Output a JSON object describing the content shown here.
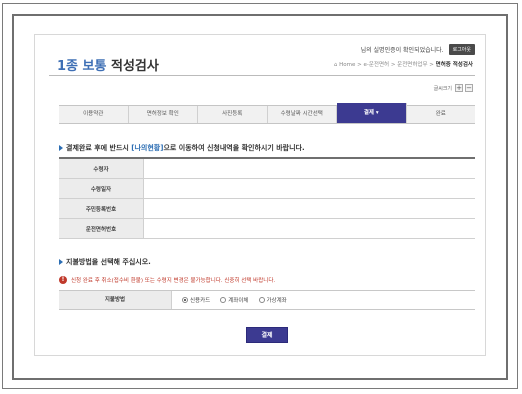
{
  "header": {
    "title_prefix": "1종 보통",
    "title": "적성검사",
    "user_message": "님의 실명인증이 확인되었습니다.",
    "logout_label": "로그아웃",
    "breadcrumb": {
      "home": "Home",
      "path": "> e-운전면허 > 운전면허업무 >",
      "current": "면허증 적성검사"
    }
  },
  "font_size": {
    "label": "글씨크기",
    "plus": "+",
    "minus": "−"
  },
  "steps": [
    {
      "label": "이용약관",
      "active": false
    },
    {
      "label": "면허정보 확인",
      "active": false
    },
    {
      "label": "사진등록",
      "active": false
    },
    {
      "label": "수령날짜 시간선택",
      "active": false
    },
    {
      "label": "결제 ▾",
      "active": true
    },
    {
      "label": "완료",
      "active": false
    }
  ],
  "notice": {
    "before": "결제완료 후에 반드시 ",
    "link": "[나의현황]",
    "after": "으로 이동하여 신청내역을 확인하시기 바랍니다."
  },
  "info_table": {
    "rows": [
      {
        "label": "수령자",
        "value": ""
      },
      {
        "label": "수령일자",
        "value": ""
      },
      {
        "label": "주민등록번호",
        "value": ""
      },
      {
        "label": "운전면허번호",
        "value": ""
      }
    ]
  },
  "payment": {
    "heading": "지불방법을 선택해 주십시오.",
    "warning": "신청 완료 후 취소(접수비 환불) 또는 수령지 변경은 불가능합니다. 신중히 선택 바랍니다.",
    "label": "지불방법",
    "options": [
      {
        "label": "신용카드",
        "selected": true
      },
      {
        "label": "계좌이체",
        "selected": false
      },
      {
        "label": "가상계좌",
        "selected": false
      }
    ],
    "submit_label": "결제"
  },
  "colors": {
    "accent": "#3c3a91",
    "link": "#2b6db3",
    "warning": "#c0392b"
  }
}
